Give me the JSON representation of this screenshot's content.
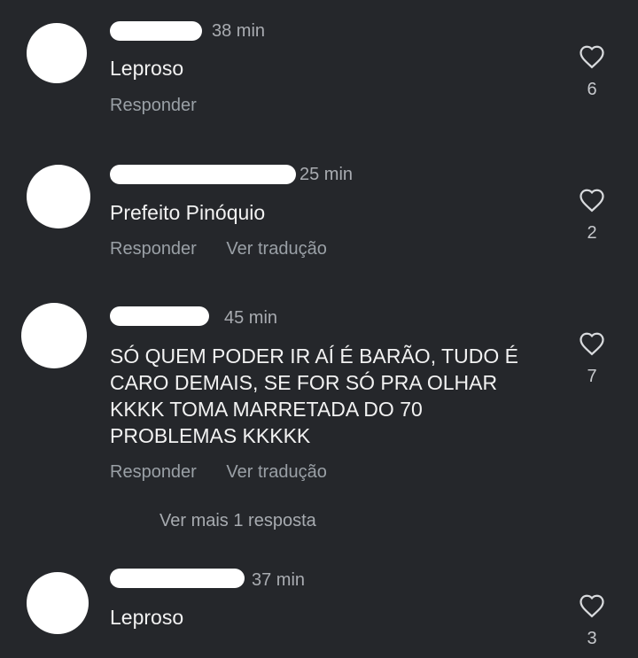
{
  "comments": [
    {
      "time": "38 min",
      "text": "Leproso",
      "actions": [
        "Responder"
      ],
      "likes": "6"
    },
    {
      "time": "25 min",
      "text": "Prefeito Pinóquio",
      "actions": [
        "Responder",
        "Ver tradução"
      ],
      "likes": "2"
    },
    {
      "time": "45 min",
      "text": "SÓ QUEM PODER IR AÍ É BARÃO, TUDO É CARO DEMAIS, SE FOR SÓ PRA OLHAR KKKK TOMA MARRETADA DO 70 PROBLEMAS KKKKK",
      "actions": [
        "Responder",
        "Ver tradução"
      ],
      "likes": "7",
      "more_replies": "Ver mais 1 resposta"
    },
    {
      "time": "37 min",
      "text": "Leproso",
      "actions": [],
      "likes": "3"
    }
  ],
  "icons": {
    "like": "heart-outline-icon"
  },
  "colors": {
    "background": "#25272b",
    "text": "#f2f2f2",
    "secondary": "#9aa0a6"
  }
}
